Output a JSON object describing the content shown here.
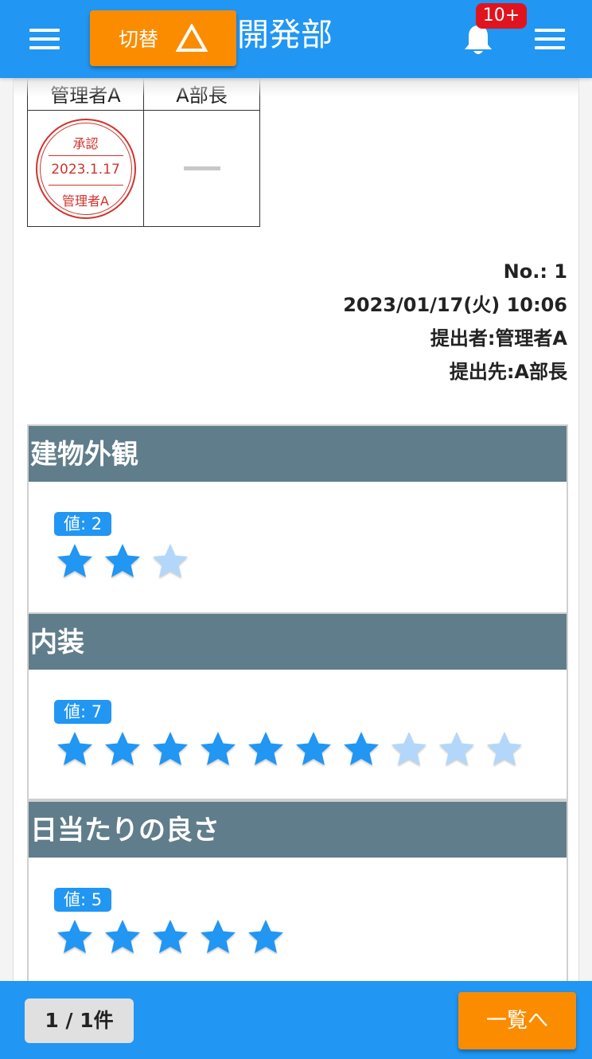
{
  "header": {
    "switch_label": "切替",
    "department": "開発部",
    "notification_badge": "10+"
  },
  "approval": {
    "approvers": [
      {
        "name": "管理者A",
        "stamp": {
          "top": "承認",
          "date": "2023.1.17",
          "bottom": "管理者A"
        }
      },
      {
        "name": "A部長",
        "status": "—"
      }
    ]
  },
  "meta": {
    "number": "No.: 1",
    "datetime": "2023/01/17(火) 10:06",
    "submitter": "提出者:管理者A",
    "recipient": "提出先:A部長"
  },
  "sections": [
    {
      "title": "建物外観",
      "value_label": "値: 2",
      "value": 2,
      "max": 3
    },
    {
      "title": "内装",
      "value_label": "値: 7",
      "value": 7,
      "max": 10
    },
    {
      "title": "日当たりの良さ",
      "value_label": "値: 5",
      "value": 5,
      "max": 5
    }
  ],
  "footer": {
    "page_count": "1 / 1件",
    "list_button": "一覧へ"
  },
  "colors": {
    "primary": "#2196f3",
    "accent": "#fb8c00",
    "section_header": "#607d8b",
    "star_filled": "#2196f3",
    "star_empty": "#b3d7fa",
    "stamp": "#d0342c"
  }
}
